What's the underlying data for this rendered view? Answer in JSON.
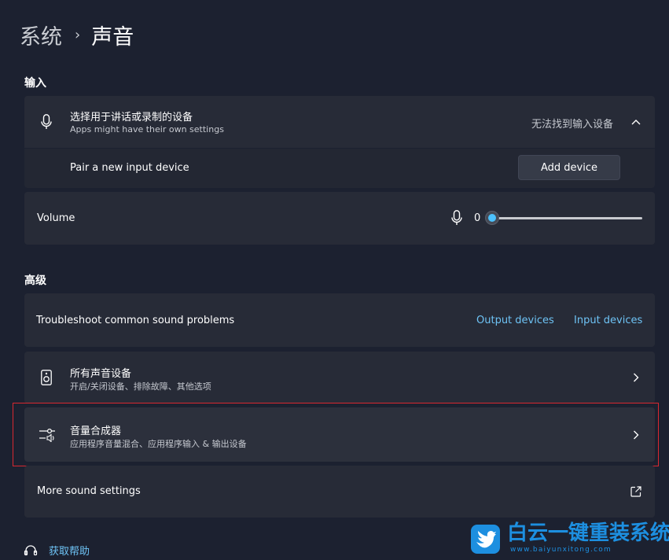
{
  "breadcrumb": {
    "parent": "系统",
    "separator": "›",
    "current": "声音"
  },
  "input_section": {
    "title": "输入",
    "device_select": {
      "title": "选择用于讲话或录制的设备",
      "subtitle": "Apps might have their own settings",
      "status": "无法找到输入设备"
    },
    "pair": {
      "label": "Pair a new input device",
      "button": "Add device"
    },
    "volume": {
      "label": "Volume",
      "value": "0",
      "level": 0
    }
  },
  "advanced_section": {
    "title": "高级",
    "troubleshoot": {
      "label": "Troubleshoot common sound problems",
      "link_output": "Output devices",
      "link_input": "Input devices"
    },
    "all_devices": {
      "title": "所有声音设备",
      "subtitle": "开启/关闭设备、排除故障、其他选项"
    },
    "mixer": {
      "title": "音量合成器",
      "subtitle": "应用程序音量混合、应用程序输入 & 输出设备"
    },
    "more": {
      "label": "More sound settings"
    }
  },
  "help": {
    "label": "获取帮助"
  },
  "watermark": {
    "brand": "白云一键重装系统",
    "url": "www.baiyunxitong.com"
  },
  "colors": {
    "accent": "#4cc2ff",
    "link": "#6ec3f5",
    "highlight": "#d9282f",
    "watermark_blue": "#1d8fe0"
  }
}
